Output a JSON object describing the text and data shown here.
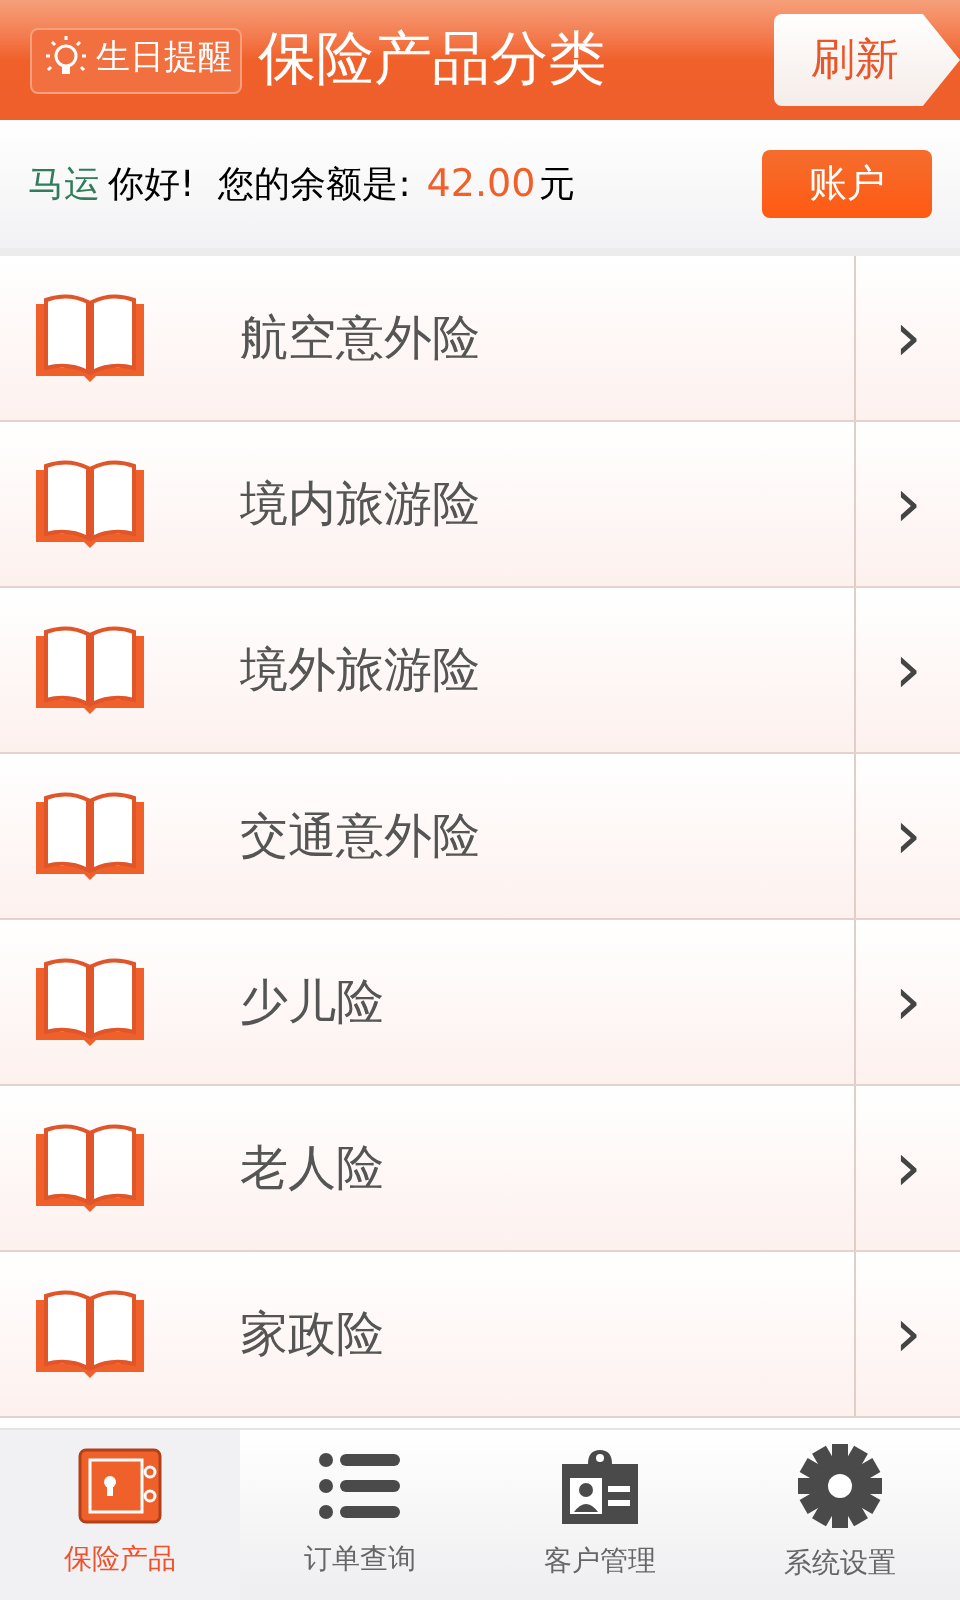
{
  "header": {
    "reminder_button": "生日提醒",
    "title": "保险产品分类",
    "refresh_button": "刷新"
  },
  "account_bar": {
    "user_name": "马运",
    "greeting": "你好!",
    "balance_label": "您的余额是:",
    "balance": "42.00",
    "currency": "元",
    "account_button": "账户"
  },
  "categories": [
    {
      "label": "航空意外险",
      "chevron": "›"
    },
    {
      "label": "境内旅游险",
      "chevron": "›"
    },
    {
      "label": "境外旅游险",
      "chevron": "›"
    },
    {
      "label": "交通意外险",
      "chevron": "›"
    },
    {
      "label": "少儿险",
      "chevron": "›"
    },
    {
      "label": "老人险",
      "chevron": "›"
    },
    {
      "label": "家政险",
      "chevron": "›"
    }
  ],
  "tab_bar": [
    {
      "label": "保险产品",
      "kind": "safe",
      "selected": true
    },
    {
      "label": "订单查询",
      "kind": "list",
      "selected": false
    },
    {
      "label": "客户管理",
      "kind": "badge",
      "selected": false
    },
    {
      "label": "系统设置",
      "kind": "gear",
      "selected": false
    }
  ]
}
